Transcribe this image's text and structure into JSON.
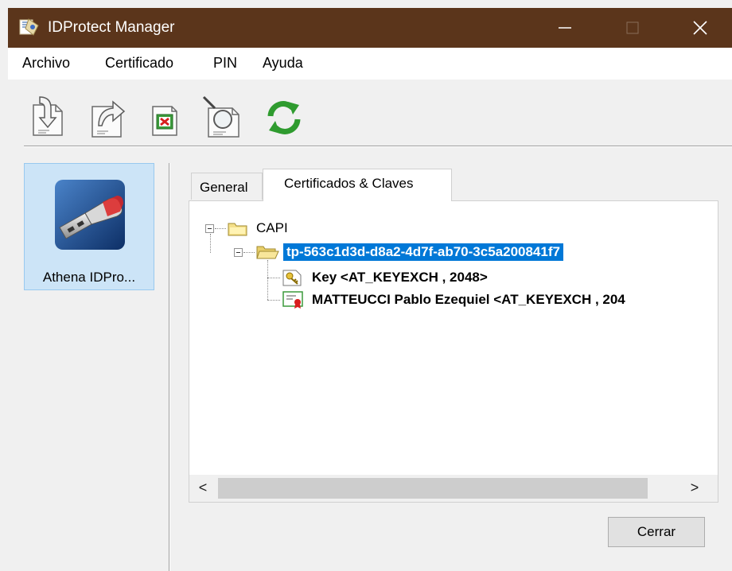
{
  "window": {
    "title": "IDProtect Manager",
    "icon": "idprotect-app-icon",
    "controls": [
      "minimize-icon",
      "maximize-icon",
      "close-icon"
    ]
  },
  "menu": {
    "items": [
      {
        "label": "Archivo"
      },
      {
        "label": "Certificado"
      },
      {
        "label": "PIN"
      },
      {
        "label": "Ayuda"
      }
    ]
  },
  "toolbar": {
    "buttons": [
      {
        "icon": "import-certificate-icon"
      },
      {
        "icon": "export-certificate-icon"
      },
      {
        "icon": "delete-certificate-icon"
      },
      {
        "icon": "view-certificate-icon"
      },
      {
        "icon": "refresh-icon"
      }
    ]
  },
  "devices": [
    {
      "label": "Athena IDPro...",
      "icon": "usb-token-icon",
      "selected": true
    }
  ],
  "tabs": [
    {
      "label": "General",
      "active": false
    },
    {
      "label": "Certificados & Claves",
      "active": true
    }
  ],
  "tree": {
    "root": {
      "label": "CAPI",
      "icon": "folder-icon",
      "expanded": true
    },
    "container": {
      "label": "tp-563c1d3d-d8a2-4d7f-ab70-3c5a200841f7",
      "icon": "open-folder-icon",
      "selected": true,
      "expanded": true
    },
    "children": [
      {
        "label": "Key  <AT_KEYEXCH , 2048>",
        "icon": "key-icon"
      },
      {
        "label": "MATTEUCCI Pablo Ezequiel <AT_KEYEXCH , 204",
        "icon": "certificate-icon"
      }
    ]
  },
  "scrollbar": {
    "left": "<",
    "right": ">"
  },
  "buttons": {
    "close_label": "Cerrar"
  },
  "colors": {
    "titlebar": "#5b351b",
    "selection": "#0078d7",
    "device_selected": "#cce4f7"
  }
}
